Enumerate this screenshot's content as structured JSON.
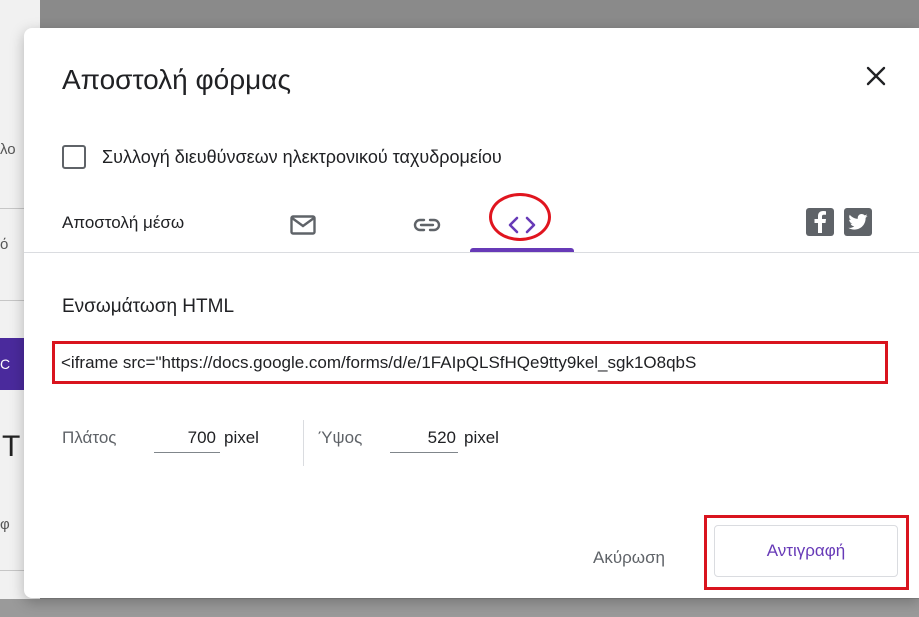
{
  "background": {
    "snippet_1": "λο",
    "snippet_2": "ό",
    "snippet_3": "C",
    "snippet_4": "Τ",
    "snippet_5": "φ"
  },
  "dialog": {
    "title": "Αποστολή φόρμας",
    "collect_emails_label": "Συλλογή διευθύνσεων ηλεκτρονικού ταχυδρομείου",
    "send_via_label": "Αποστολή μέσω",
    "embed_heading": "Ενσωμάτωση HTML",
    "embed_code": "<iframe src=\"https://docs.google.com/forms/d/e/1FAIpQLSfHQe9tty9kel_sgk1O8qbS",
    "width_label": "Πλάτος",
    "width_value": "700",
    "height_label": "Ύψος",
    "height_value": "520",
    "unit": "pixel",
    "cancel_label": "Ακύρωση",
    "copy_label": "Αντιγραφή"
  },
  "colors": {
    "accent": "#673ab7",
    "highlight": "#d9141e",
    "icon": "#5f6368"
  },
  "icons": [
    "close-icon",
    "email-icon",
    "link-icon",
    "embed-code-icon",
    "facebook-icon",
    "twitter-icon"
  ]
}
